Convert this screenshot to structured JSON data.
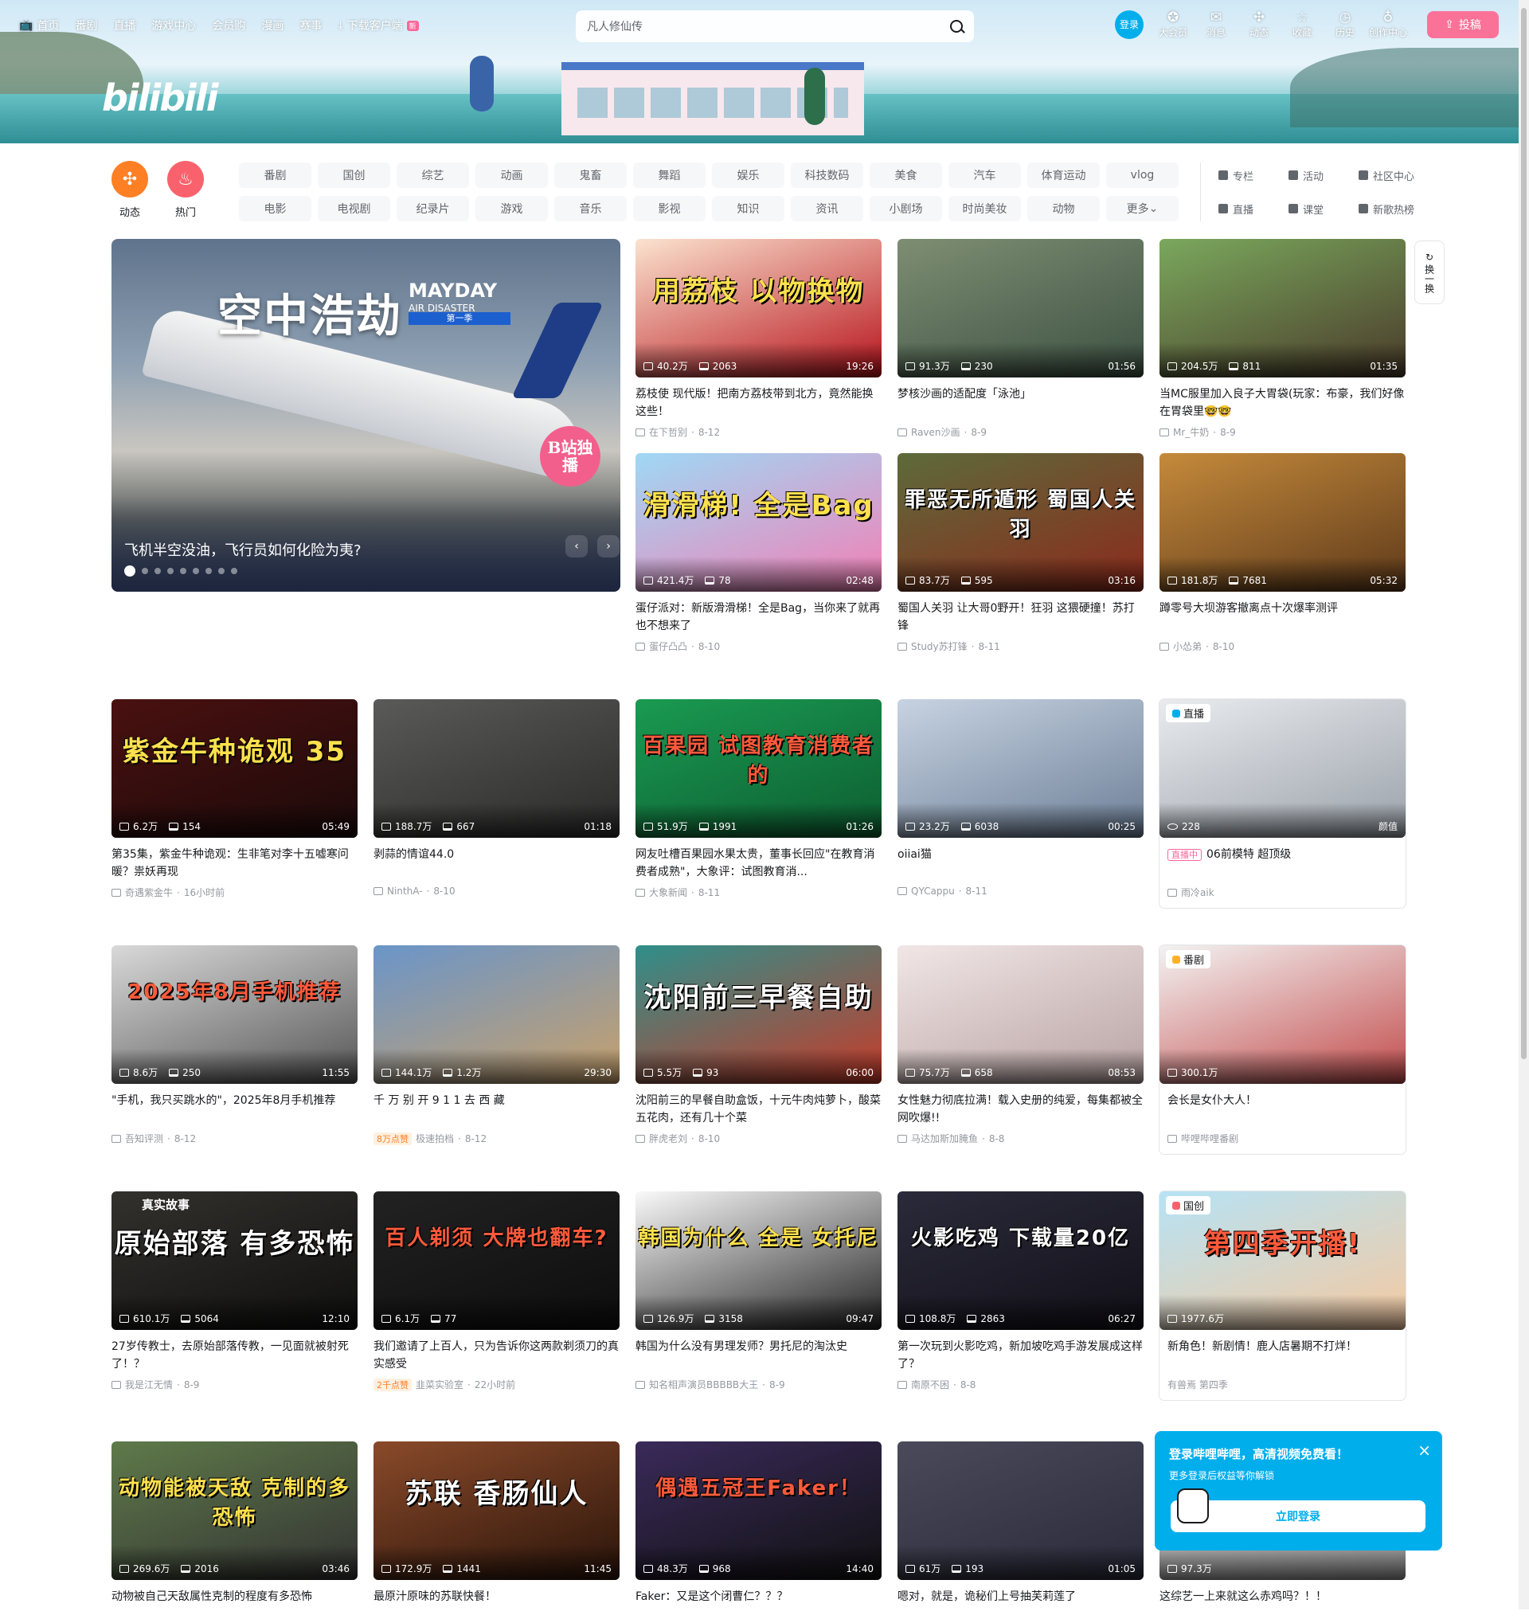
{
  "topnav": {
    "items": [
      "首页",
      "番剧",
      "直播",
      "游戏中心",
      "会员购",
      "漫画",
      "赛事",
      "下载客户端"
    ],
    "new_badge": "新"
  },
  "logo": "bilibili",
  "search": {
    "placeholder": "凡人修仙传"
  },
  "rightnav": {
    "login": "登录",
    "items": [
      "大会员",
      "消息",
      "动态",
      "收藏",
      "历史",
      "创作中心"
    ],
    "upload": "投稿"
  },
  "channels": {
    "big": [
      {
        "label": "动态",
        "color": "#ff7f24"
      },
      {
        "label": "热门",
        "color": "#f9626d"
      }
    ],
    "chips": [
      "番剧",
      "国创",
      "综艺",
      "动画",
      "鬼畜",
      "舞蹈",
      "娱乐",
      "科技数码",
      "美食",
      "汽车",
      "体育运动",
      "vlog",
      "电影",
      "电视剧",
      "纪录片",
      "游戏",
      "音乐",
      "影视",
      "知识",
      "资讯",
      "小剧场",
      "时尚美妆",
      "动物",
      "更多"
    ],
    "ext": [
      "专栏",
      "活动",
      "社区中心",
      "直播",
      "课堂",
      "新歌热榜"
    ]
  },
  "carousel": {
    "title": "飞机半空没油，飞行员如何化险为夷?",
    "headline": "空中浩劫",
    "english_1": "MAYDAY",
    "english_2": "AIR DISASTER",
    "season": "第一季",
    "badge": "B站独播",
    "prev": "‹",
    "next": "›",
    "dots": 9,
    "active_dot": 0
  },
  "refresh": {
    "label": "换一换"
  },
  "cards": [
    {
      "title": "荔枝使 现代版！把南方荔枝带到北方，竟然能换这些！",
      "views": "40.2万",
      "comments": "2063",
      "duration": "19:26",
      "author": "在下哲别",
      "date": "8-12",
      "thumb_text": "用荔枝 以物换物",
      "colors": [
        "#fbe3cf",
        "#b7121b"
      ]
    },
    {
      "title": "梦核沙画的适配度「泳池」",
      "views": "91.3万",
      "comments": "230",
      "duration": "01:56",
      "author": "Raven沙画",
      "date": "8-9",
      "thumb_text": "",
      "colors": [
        "#7d8e72",
        "#3d5143"
      ]
    },
    {
      "title": "当MC服里加入良子大胃袋(玩家：布豪，我们好像在胃袋里🤓🤓",
      "views": "204.5万",
      "comments": "811",
      "duration": "01:35",
      "author": "Mr_牛奶",
      "date": "8-9",
      "thumb_text": "",
      "colors": [
        "#7aa85d",
        "#4a3b2a"
      ]
    },
    {
      "title": "蛋仔派对：新版滑滑梯！全是Bag，当你来了就再也不想来了",
      "views": "421.4万",
      "comments": "78",
      "duration": "02:48",
      "author": "蛋仔凸凸",
      "date": "8-10",
      "thumb_text": "滑滑梯! 全是Bag",
      "colors": [
        "#9fd8f5",
        "#f37fb5"
      ]
    },
    {
      "title": "蜀国人关羽 让大哥0野开！狂羽 这猥硬撞！苏打锋",
      "views": "83.7万",
      "comments": "595",
      "duration": "03:16",
      "author": "Study苏打锋",
      "date": "8-11",
      "thumb_text": "罪恶无所遁形 蜀国人关羽",
      "colors": [
        "#5c6b3a",
        "#8c2a1c"
      ]
    },
    {
      "title": "蹲零号大坝游客撤离点十次爆率测评",
      "views": "181.8万",
      "comments": "7681",
      "duration": "05:32",
      "author": "小怂弟",
      "date": "8-10",
      "thumb_text": "",
      "colors": [
        "#c58a3b",
        "#5e3a1a"
      ]
    },
    {
      "title": "第35集，紫金牛种诡观：生非笔对李十五嘘寒问暖？祟妖再现",
      "views": "6.2万",
      "comments": "154",
      "duration": "05:49",
      "author": "奇遇紫金牛",
      "date": "16小时前",
      "thumb_text": "紫金牛种诡观 35",
      "colors": [
        "#4a1010",
        "#1c0a0a"
      ]
    },
    {
      "title": "剥蒜的情谊44.0",
      "views": "188.7万",
      "comments": "667",
      "duration": "01:18",
      "author": "NinthA-",
      "date": "8-10",
      "thumb_text": "",
      "colors": [
        "#5a5a58",
        "#2a2a2a"
      ]
    },
    {
      "title": "网友吐槽百果园水果太贵，董事长回应\"在教育消费者成熟\"，大象评：试图教育消...",
      "views": "51.9万",
      "comments": "1991",
      "duration": "01:26",
      "author": "大象新闻",
      "date": "8-11",
      "thumb_text": "百果园 试图教育消费者的",
      "colors": [
        "#1a9a52",
        "#0d5e31"
      ]
    },
    {
      "title": "oiiai猫",
      "views": "23.2万",
      "comments": "6038",
      "duration": "00:25",
      "author": "QYCappu",
      "date": "8-11",
      "thumb_text": "",
      "colors": [
        "#c7d3e2",
        "#6d7f97"
      ]
    },
    {
      "title": "06前模特 超顶级",
      "views": "228",
      "comments": "",
      "duration": "颜值",
      "author": "雨冷aik",
      "date": "",
      "thumb_text": "",
      "colors": [
        "#e9ebee",
        "#9aa1aa"
      ],
      "tag": "直播",
      "live_badge": "直播中"
    },
    {
      "title": "\"手机，我只买跳水的\"，2025年8月手机推荐",
      "views": "8.6万",
      "comments": "250",
      "duration": "11:55",
      "author": "吾知评测",
      "date": "8-12",
      "thumb_text": "2025年8月手机推荐",
      "colors": [
        "#d9d9d9",
        "#555"
      ]
    },
    {
      "title": "千 万 别 开 9 1 1 去 西 藏",
      "views": "144.1万",
      "comments": "1.2万",
      "duration": "29:30",
      "author": "极速拍档",
      "date": "8-12",
      "thumb_text": "",
      "colors": [
        "#6a95c9",
        "#c8a16a"
      ],
      "likes": "8万点赞"
    },
    {
      "title": "沈阳前三的早餐自助盒饭，十元牛肉炖萝卜，酸菜五花肉，还有几十个菜",
      "views": "5.5万",
      "comments": "93",
      "duration": "06:00",
      "author": "胖虎老刘",
      "date": "8-10",
      "thumb_text": "沈阳前三早餐自助",
      "colors": [
        "#2f8f8a",
        "#c73b2a"
      ]
    },
    {
      "title": "女性魅力彻底拉满！载入史册的纯爱，每集都被全网吹爆!!",
      "views": "75.7万",
      "comments": "658",
      "duration": "08:53",
      "author": "马达加斯加腌鱼",
      "date": "8-8",
      "thumb_text": "",
      "colors": [
        "#f1e6e6",
        "#b8a2a2"
      ]
    },
    {
      "title": "会长是女仆大人！",
      "views": "300.1万",
      "comments": "",
      "duration": "",
      "author": "哔哩哔哩番剧",
      "date": "",
      "thumb_text": "",
      "colors": [
        "#f3f3f3",
        "#c24b4b"
      ],
      "tag": "番剧"
    },
    {
      "title": "27岁传教士，去原始部落传教，一见面就被射死了！？",
      "views": "610.1万",
      "comments": "5064",
      "duration": "12:10",
      "author": "我是江无情",
      "date": "8-9",
      "thumb_text": "原始部落 有多恐怖",
      "colors": [
        "#33312d",
        "#0f0f0f"
      ],
      "corner": "真实故事"
    },
    {
      "title": "我们邀请了上百人，只为告诉你这两款剃须刀的真实感受",
      "views": "6.1万",
      "comments": "77",
      "duration": "",
      "author": "韭菜实验室",
      "date": "22小时前",
      "thumb_text": "百人剃须 大牌也翻车?",
      "colors": [
        "#222",
        "#0d0d0d"
      ],
      "likes": "2千点赞"
    },
    {
      "title": "韩国为什么没有男理发师？男托尼的淘汰史",
      "views": "126.9万",
      "comments": "3158",
      "duration": "09:47",
      "author": "知名相声演员BBBBB大王",
      "date": "8-9",
      "thumb_text": "韩国为什么 全是 女托尼",
      "colors": [
        "#fafafa",
        "#222"
      ]
    },
    {
      "title": "第一次玩到火影吃鸡，新加坡吃鸡手游发展成这样了？",
      "views": "108.8万",
      "comments": "2863",
      "duration": "06:27",
      "author": "南原不困",
      "date": "8-8",
      "thumb_text": "火影吃鸡 下载量20亿",
      "colors": [
        "#2b2a3a",
        "#121018"
      ]
    },
    {
      "title": "新角色！新剧情！鹿人店暑期不打烊！",
      "views": "1977.6万",
      "comments": "",
      "duration": "",
      "author": "有兽焉 第四季",
      "date": "",
      "thumb_text": "第四季开播!",
      "colors": [
        "#b6e3f5",
        "#f5c9a0"
      ],
      "tag": "国创"
    },
    {
      "title": "动物被自己天敌属性克制的程度有多恐怖",
      "views": "269.6万",
      "comments": "2016",
      "duration": "03:46",
      "author": "",
      "date": "",
      "thumb_text": "动物能被天敌 克制的多恐怖",
      "colors": [
        "#5f7a4a",
        "#333"
      ]
    },
    {
      "title": "最原汁原味的苏联快餐！",
      "views": "172.9万",
      "comments": "1441",
      "duration": "11:45",
      "author": "",
      "date": "",
      "thumb_text": "苏联 香肠仙人",
      "colors": [
        "#8a4a2a",
        "#2a140a"
      ]
    },
    {
      "title": "Faker：又是这个闭曹仁？？？",
      "views": "48.3万",
      "comments": "968",
      "duration": "14:40",
      "author": "",
      "date": "",
      "thumb_text": "偶遇五冠王Faker！",
      "colors": [
        "#3a2a5a",
        "#111"
      ]
    },
    {
      "title": "嗯对，就是，诡秘们上号抽芙莉莲了",
      "views": "61万",
      "comments": "193",
      "duration": "01:05",
      "author": "",
      "date": "",
      "thumb_text": "",
      "colors": [
        "#4a4a5a",
        "#2a2a3a"
      ]
    },
    {
      "title": "这综艺一上来就这么赤鸡吗？！！",
      "views": "97.3万",
      "comments": "",
      "duration": "",
      "author": "",
      "date": "",
      "thumb_text": "",
      "colors": [
        "#ccc",
        "#999"
      ]
    }
  ],
  "popup": {
    "title": "登录哔哩哔哩，高清视频免费看！",
    "subtitle": "更多登录后权益等你解锁",
    "button": "立即登录",
    "close": "×"
  }
}
